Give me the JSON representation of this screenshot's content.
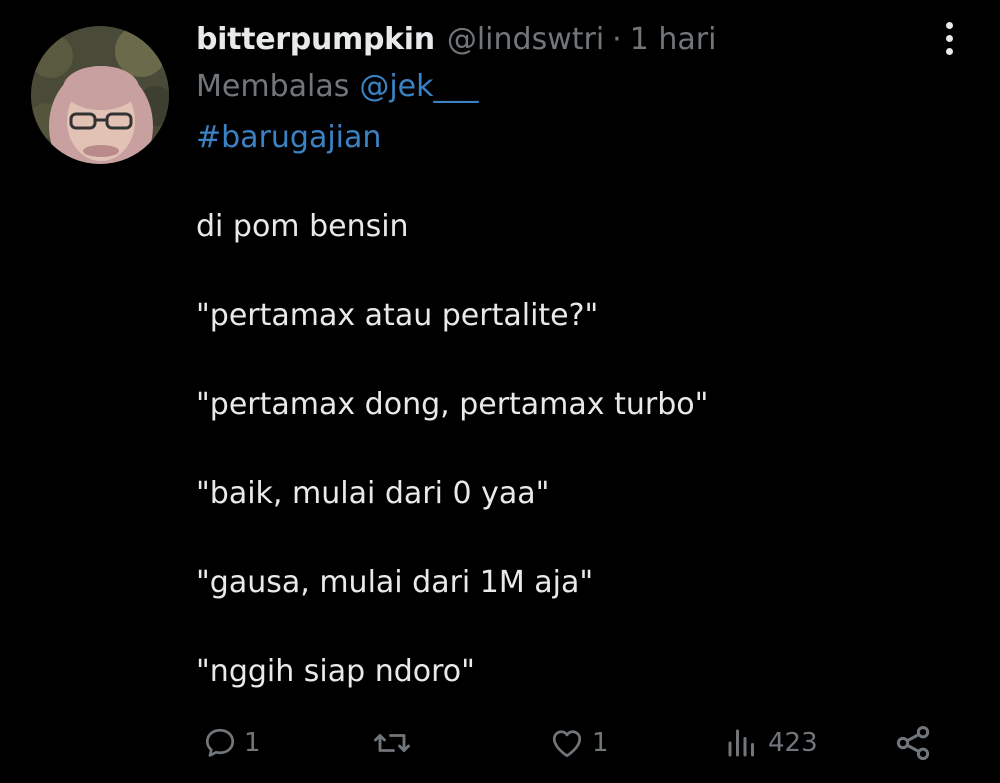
{
  "post": {
    "display_name": "bitterpumpkin",
    "handle": "@lindswtri",
    "separator": "·",
    "time": "1 hari",
    "reply_prefix": "Membalas",
    "reply_to": "@jek___",
    "hashtag": "#barugajian",
    "lines": [
      "di pom bensin",
      "\"pertamax atau pertalite?\"",
      "\"pertamax dong, pertamax turbo\"",
      "\"baik, mulai dari 0 yaa\"",
      "\"gausa, mulai dari 1M aja\"",
      "\"nggih siap ndoro\""
    ]
  },
  "actions": {
    "reply_count": "1",
    "retweet_count": "",
    "like_count": "1",
    "views_count": "423"
  },
  "icons": {
    "reply": "comment-icon",
    "retweet": "retweet-icon",
    "like": "heart-icon",
    "views": "views-chart-icon",
    "share": "share-icon",
    "more": "more-vertical-icon"
  },
  "colors": {
    "background": "#000000",
    "text": "#e7e9ea",
    "muted": "#71767b",
    "link": "#3b82c4"
  }
}
